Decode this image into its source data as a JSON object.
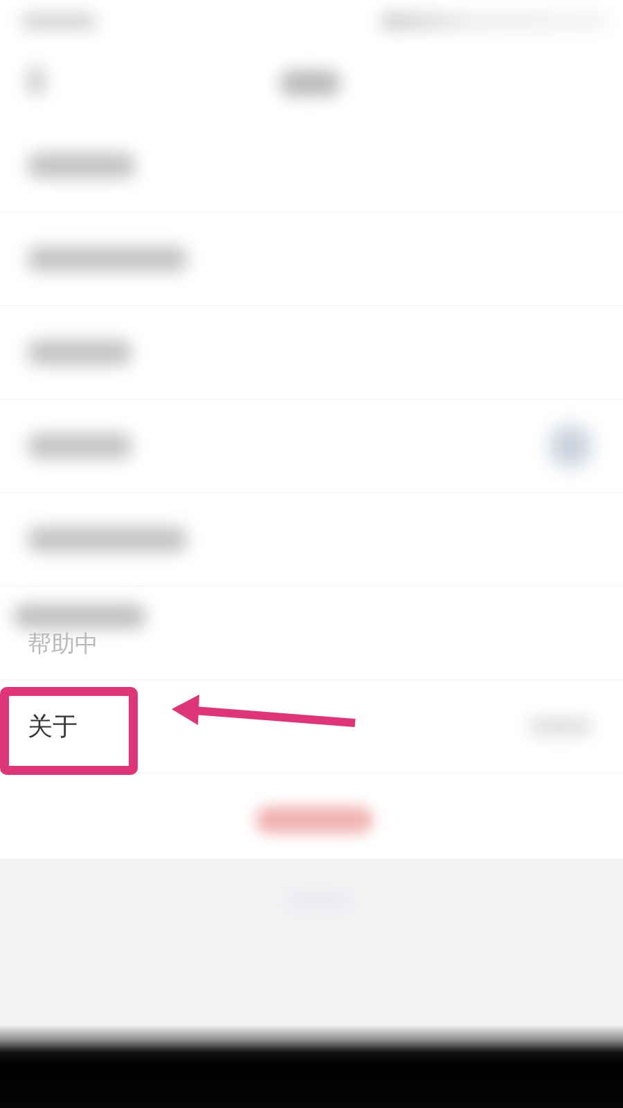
{
  "rows": [
    {
      "kind": "blurred",
      "highlighted": false
    },
    {
      "kind": "blurred",
      "highlighted": false
    },
    {
      "kind": "blurred",
      "highlighted": false
    },
    {
      "kind": "blurred_toggle",
      "highlighted": false
    },
    {
      "kind": "blurred",
      "highlighted": false
    },
    {
      "kind": "faded",
      "label": "帮助中",
      "highlighted": false
    },
    {
      "kind": "plain",
      "label": "关于",
      "highlighted": true
    }
  ]
}
